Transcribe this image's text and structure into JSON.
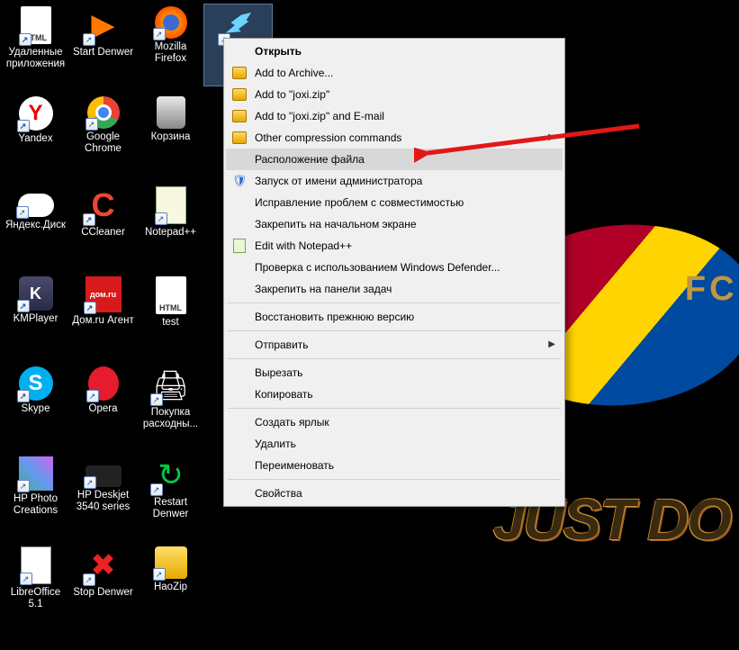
{
  "background": {
    "slogan": "JUST DO",
    "logo_text": "FCB"
  },
  "icons": [
    {
      "name": "deleted-apps",
      "label": "Удаленные приложения",
      "cls": "i-html",
      "inner": "HTML",
      "shortcut": true
    },
    {
      "name": "start-denwer",
      "label": "Start Denwer",
      "cls": "i-denwer",
      "inner": "▶",
      "shortcut": true
    },
    {
      "name": "firefox",
      "label": "Mozilla Firefox",
      "cls": "i-firefox",
      "inner": "",
      "shortcut": true
    },
    {
      "name": "joxi",
      "label": "",
      "cls": "i-bird",
      "inner": "",
      "shortcut": true,
      "selected": true
    },
    {
      "name": "yandex",
      "label": "Yandex",
      "cls": "i-yandex",
      "inner": "Y",
      "shortcut": true
    },
    {
      "name": "chrome",
      "label": "Google Chrome",
      "cls": "i-chrome",
      "inner": "",
      "shortcut": true
    },
    {
      "name": "trash",
      "label": "Корзина",
      "cls": "i-trash",
      "inner": "",
      "shortcut": false
    },
    {
      "name": "blank1",
      "label": "",
      "cls": "",
      "inner": "",
      "shortcut": false,
      "empty": true
    },
    {
      "name": "ydisk",
      "label": "Яндекс.Диск",
      "cls": "i-ydisk",
      "inner": "",
      "shortcut": true
    },
    {
      "name": "ccleaner",
      "label": "CCleaner",
      "cls": "i-ccleaner",
      "inner": "C",
      "shortcut": true
    },
    {
      "name": "notepadpp",
      "label": "Notepad++",
      "cls": "i-npp",
      "inner": "",
      "shortcut": true
    },
    {
      "name": "blank2",
      "label": "",
      "cls": "",
      "inner": "",
      "shortcut": false,
      "empty": true
    },
    {
      "name": "kmplayer",
      "label": "KMPlayer",
      "cls": "i-kmp",
      "inner": "K",
      "shortcut": true
    },
    {
      "name": "domru",
      "label": "Дом.ru Агент",
      "cls": "i-domru",
      "inner": "дом.ru",
      "shortcut": true
    },
    {
      "name": "test",
      "label": "test",
      "cls": "i-html",
      "inner": "HTML",
      "shortcut": false
    },
    {
      "name": "blank3",
      "label": "",
      "cls": "",
      "inner": "",
      "shortcut": false,
      "empty": true
    },
    {
      "name": "skype",
      "label": "Skype",
      "cls": "i-skype",
      "inner": "S",
      "shortcut": true
    },
    {
      "name": "opera",
      "label": "Opera",
      "cls": "i-opera",
      "inner": "",
      "shortcut": true
    },
    {
      "name": "purchase",
      "label": "Покупка расходны...",
      "cls": "i-printer",
      "inner": "🖨",
      "shortcut": true
    },
    {
      "name": "blank4",
      "label": "",
      "cls": "",
      "inner": "",
      "shortcut": false,
      "empty": true
    },
    {
      "name": "hpphoto",
      "label": "HP Photo Creations",
      "cls": "i-hpphoto",
      "inner": "",
      "shortcut": true
    },
    {
      "name": "hpdeskjet",
      "label": "HP Deskjet 3540 series",
      "cls": "i-hpdesk",
      "inner": "",
      "shortcut": true
    },
    {
      "name": "restart-denwer",
      "label": "Restart Denwer",
      "cls": "i-restart",
      "inner": "↻",
      "shortcut": true
    },
    {
      "name": "blank5",
      "label": "",
      "cls": "",
      "inner": "",
      "shortcut": false,
      "empty": true
    },
    {
      "name": "libreoffice",
      "label": "LibreOffice 5.1",
      "cls": "i-libre",
      "inner": "",
      "shortcut": true
    },
    {
      "name": "stop-denwer",
      "label": "Stop Denwer",
      "cls": "i-stop",
      "inner": "✖",
      "shortcut": true
    },
    {
      "name": "haozip",
      "label": "HaoZip",
      "cls": "i-haozip",
      "inner": "",
      "shortcut": true
    }
  ],
  "menu": [
    {
      "type": "item",
      "label": "Открыть",
      "bold": true
    },
    {
      "type": "item",
      "label": "Add to Archive...",
      "icon": "arch"
    },
    {
      "type": "item",
      "label": "Add to \"joxi.zip\"",
      "icon": "arch"
    },
    {
      "type": "item",
      "label": "Add to \"joxi.zip\" and E-mail",
      "icon": "arch"
    },
    {
      "type": "item",
      "label": "Other compression commands",
      "icon": "arch",
      "submenu": true
    },
    {
      "type": "item",
      "label": "Расположение файла",
      "highlight": true
    },
    {
      "type": "item",
      "label": "Запуск от имени администратора",
      "icon": "shield"
    },
    {
      "type": "item",
      "label": "Исправление проблем с совместимостью"
    },
    {
      "type": "item",
      "label": "Закрепить на начальном экране"
    },
    {
      "type": "item",
      "label": "Edit with Notepad++",
      "icon": "npp"
    },
    {
      "type": "item",
      "label": "Проверка с использованием Windows Defender..."
    },
    {
      "type": "item",
      "label": "Закрепить на панели задач"
    },
    {
      "type": "sep"
    },
    {
      "type": "item",
      "label": "Восстановить прежнюю версию"
    },
    {
      "type": "sep"
    },
    {
      "type": "item",
      "label": "Отправить",
      "submenu": true
    },
    {
      "type": "sep"
    },
    {
      "type": "item",
      "label": "Вырезать"
    },
    {
      "type": "item",
      "label": "Копировать"
    },
    {
      "type": "sep"
    },
    {
      "type": "item",
      "label": "Создать ярлык"
    },
    {
      "type": "item",
      "label": "Удалить"
    },
    {
      "type": "item",
      "label": "Переименовать"
    },
    {
      "type": "sep"
    },
    {
      "type": "item",
      "label": "Свойства"
    }
  ]
}
